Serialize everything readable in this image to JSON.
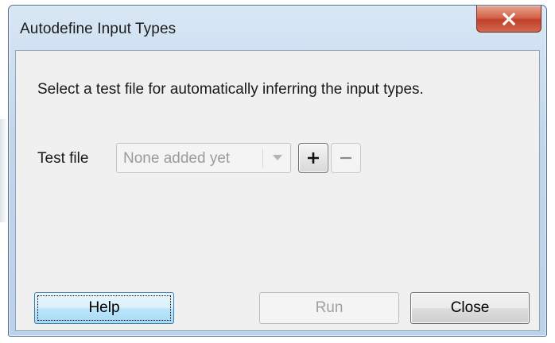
{
  "window": {
    "title": "Autodefine Input Types"
  },
  "titlebar_buttons": {
    "close_icon": "close-x-icon"
  },
  "content": {
    "instruction": "Select a test file for automatically inferring the input types.",
    "test_file_label": "Test file",
    "test_file_dropdown": {
      "selected": "None added yet",
      "enabled": false
    },
    "add_button_icon": "plus-icon",
    "remove_button_icon": "minus-icon"
  },
  "buttons": {
    "help": "Help",
    "run": "Run",
    "close": "Close"
  },
  "colors": {
    "titlebar_close": "#c8452e",
    "dialog_bg": "#f0f0f0",
    "frame": "#c3d6ea",
    "disabled_text": "#9b9b9b"
  }
}
